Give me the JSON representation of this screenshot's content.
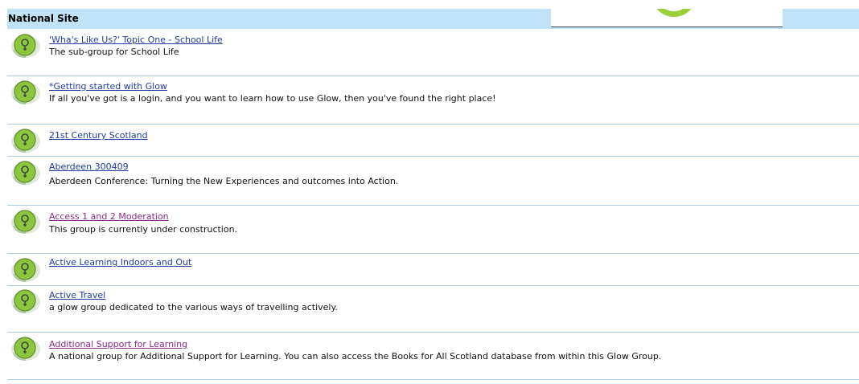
{
  "header": {
    "title": "National Site"
  },
  "colors": {
    "header_bg": "#bfe2f6",
    "link": "#1f3ca6",
    "visited_link": "#8a2a88",
    "divider": "#a9cfe6",
    "icon_green": "#8cc63f"
  },
  "groups": [
    {
      "title": "'Wha's Like Us?' Topic One - School Life",
      "description": "The sub-group for School Life",
      "visited": false,
      "icon": "glow-group-icon"
    },
    {
      "title": "*Getting started with Glow",
      "description": "If all you've got is a login, and you want to learn how to use Glow, then you've found the right place!",
      "visited": false,
      "icon": "glow-group-icon"
    },
    {
      "title": "21st Century Scotland",
      "description": "",
      "visited": false,
      "icon": "glow-group-icon"
    },
    {
      "title": "Aberdeen 300409",
      "description": "Aberdeen Conference: Turning the New Experiences and outcomes into Action.",
      "visited": false,
      "icon": "glow-group-icon"
    },
    {
      "title": "Access 1 and 2 Moderation",
      "description": "This group is currently under construction.",
      "visited": true,
      "icon": "glow-group-icon"
    },
    {
      "title": "Active Learning Indoors and Out",
      "description": "",
      "visited": false,
      "icon": "glow-group-icon"
    },
    {
      "title": "Active Travel",
      "description": "a glow group dedicated to the various ways of travelling actively.",
      "visited": false,
      "icon": "glow-group-icon"
    },
    {
      "title": "Additional Support for Learning",
      "description": "A national group for Additional Support for Learning. You can also access the Books for All Scotland database from within this Glow Group.",
      "visited": true,
      "icon": "glow-group-icon"
    }
  ]
}
